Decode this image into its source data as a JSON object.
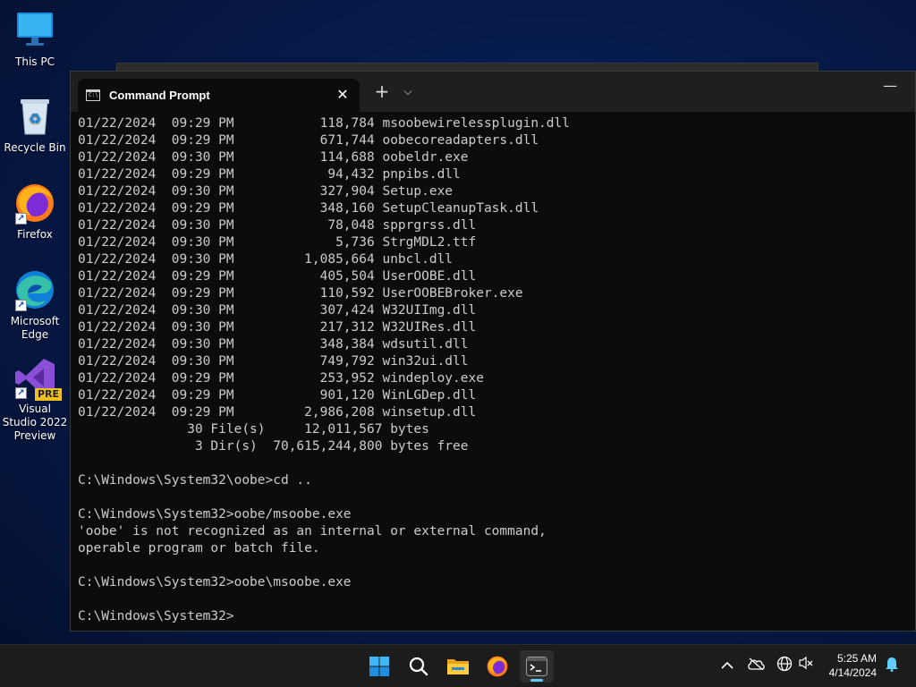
{
  "desktop": {
    "icons": [
      {
        "label": "This PC",
        "icon": "computer-icon"
      },
      {
        "label": "Recycle Bin",
        "icon": "recycle-bin-icon"
      },
      {
        "label": "Firefox",
        "icon": "firefox-icon"
      },
      {
        "label": "Microsoft Edge",
        "icon": "edge-icon"
      },
      {
        "label": "Visual Studio 2022 Preview",
        "icon": "visual-studio-icon",
        "badge": "PRE"
      }
    ]
  },
  "terminal": {
    "tab_title": "Command Prompt",
    "close_glyph": "✕",
    "new_tab_glyph": "+",
    "dropdown_glyph": "⌵",
    "minimize_glyph": "—",
    "lines": [
      "01/22/2024  09:29 PM           118,784 msoobewirelessplugin.dll",
      "01/22/2024  09:29 PM           671,744 oobecoreadapters.dll",
      "01/22/2024  09:30 PM           114,688 oobeldr.exe",
      "01/22/2024  09:29 PM            94,432 pnpibs.dll",
      "01/22/2024  09:30 PM           327,904 Setup.exe",
      "01/22/2024  09:29 PM           348,160 SetupCleanupTask.dll",
      "01/22/2024  09:30 PM            78,048 spprgrss.dll",
      "01/22/2024  09:30 PM             5,736 StrgMDL2.ttf",
      "01/22/2024  09:30 PM         1,085,664 unbcl.dll",
      "01/22/2024  09:29 PM           405,504 UserOOBE.dll",
      "01/22/2024  09:29 PM           110,592 UserOOBEBroker.exe",
      "01/22/2024  09:30 PM           307,424 W32UIImg.dll",
      "01/22/2024  09:30 PM           217,312 W32UIRes.dll",
      "01/22/2024  09:30 PM           348,384 wdsutil.dll",
      "01/22/2024  09:30 PM           749,792 win32ui.dll",
      "01/22/2024  09:29 PM           253,952 windeploy.exe",
      "01/22/2024  09:29 PM           901,120 WinLGDep.dll",
      "01/22/2024  09:29 PM         2,986,208 winsetup.dll",
      "              30 File(s)     12,011,567 bytes",
      "               3 Dir(s)  70,615,244,800 bytes free",
      "",
      "C:\\Windows\\System32\\oobe>cd ..",
      "",
      "C:\\Windows\\System32>oobe/msoobe.exe",
      "'oobe' is not recognized as an internal or external command,",
      "operable program or batch file.",
      "",
      "C:\\Windows\\System32>oobe\\msoobe.exe",
      "",
      "C:\\Windows\\System32>"
    ]
  },
  "taskbar": {
    "items": [
      "start-icon",
      "search-icon",
      "file-explorer-icon",
      "firefox-icon",
      "terminal-icon"
    ],
    "tray": [
      "chevron-up-icon",
      "onedrive-icon",
      "network-icon",
      "speaker-muted-icon",
      "notification-bell-icon"
    ],
    "time": "5:25 AM",
    "date": "4/14/2024"
  }
}
